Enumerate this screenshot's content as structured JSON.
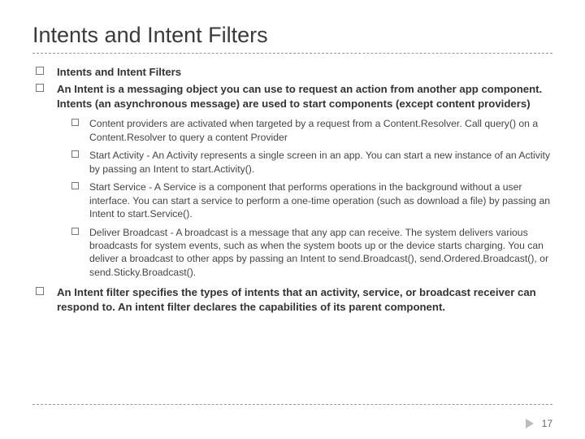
{
  "title": "Intents and Intent Filters",
  "bullets": {
    "b1": "Intents and Intent Filters",
    "b2_pre": "An Intent is a messaging object you can use to request an action from another app component. ",
    "b2_bold": "Intents",
    "b2_post": " (an asynchronous message) are used to start components (except content providers)",
    "sub": {
      "s1": "Content providers are activated when targeted by a request from a Content.Resolver. Call query() on a Content.Resolver to query a content Provider",
      "s2": "Start Activity - An Activity represents a single screen in an app. You can start a new instance of an Activity by passing an Intent to start.Activity().",
      "s3": "Start Service - A Service is a component that performs operations in the background without a user interface. You can start a service to perform a one-time operation (such as download a file) by passing an Intent to start.Service().",
      "s4": "Deliver Broadcast - A broadcast is a message that any app can receive. The system delivers various broadcasts for system events, such as when the system boots up or the device starts charging. You can deliver a broadcast to other apps by passing an Intent to send.Broadcast(), send.Ordered.Broadcast(), or send.Sticky.Broadcast()."
    },
    "b3": "An Intent filter specifies the types of intents that an activity, service, or broadcast receiver can respond to. An intent filter declares the capabilities of its parent component."
  },
  "page": "17"
}
